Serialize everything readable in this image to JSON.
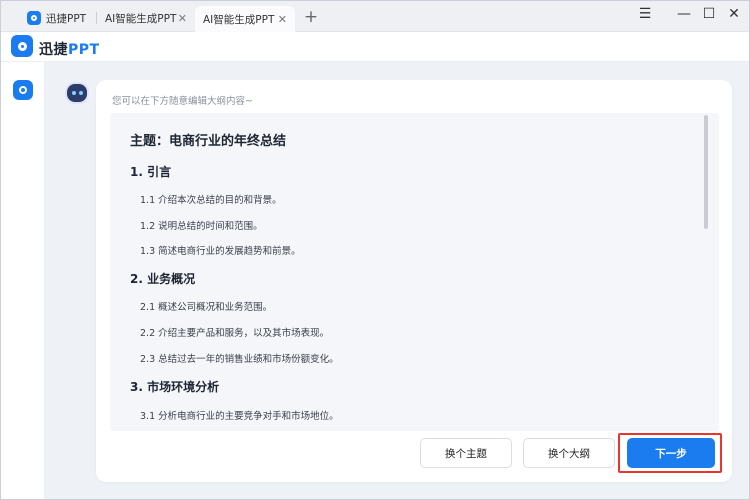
{
  "tabs": [
    {
      "label": "迅捷PPT",
      "active": false
    },
    {
      "label": "AI智能生成PPT",
      "active": false
    },
    {
      "label": "AI智能生成PPT",
      "active": true
    }
  ],
  "window_controls": {
    "menu": "☰",
    "minimize": "—",
    "maximize": "☐",
    "close": "✕"
  },
  "tab_close": "✕",
  "new_tab": "+",
  "app": {
    "name_prefix": "迅捷",
    "name_suffix": "PPT"
  },
  "hint": "您可以在下方随意编辑大纲内容~",
  "outline": {
    "title": "主题：电商行业的年终总结",
    "sections": [
      {
        "heading": "1. 引言",
        "items": [
          "1.1 介绍本次总结的目的和背景。",
          "1.2 说明总结的时间和范围。",
          "1.3 简述电商行业的发展趋势和前景。"
        ]
      },
      {
        "heading": "2. 业务概况",
        "items": [
          "2.1 概述公司概况和业务范围。",
          "2.2 介绍主要产品和服务，以及其市场表现。",
          "2.3 总结过去一年的销售业绩和市场份额变化。"
        ]
      },
      {
        "heading": "3. 市场环境分析",
        "items": [
          "3.1 分析电商行业的主要竞争对手和市场地位。"
        ]
      }
    ]
  },
  "buttons": {
    "change_topic": "换个主题",
    "change_outline": "换个大纲",
    "next": "下一步"
  },
  "colors": {
    "accent": "#1b7cf0",
    "highlight_border": "#e8362f"
  }
}
